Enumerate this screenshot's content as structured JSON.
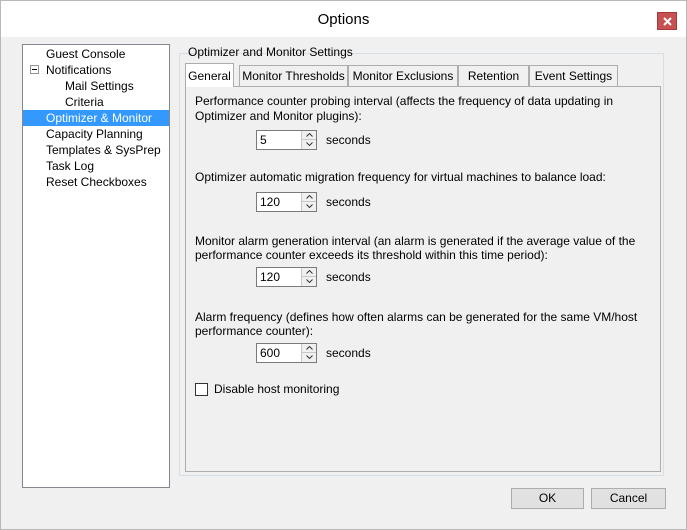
{
  "window": {
    "title": "Options"
  },
  "nav": {
    "items": [
      {
        "label": "Guest Console",
        "selected": false,
        "indent": 0
      },
      {
        "label": "Notifications",
        "selected": false,
        "indent": 0,
        "expander": "minus"
      },
      {
        "label": "Mail Settings",
        "selected": false,
        "indent": 2
      },
      {
        "label": "Criteria",
        "selected": false,
        "indent": 2
      },
      {
        "label": "Optimizer & Monitor",
        "selected": true,
        "indent": 0
      },
      {
        "label": "Capacity Planning",
        "selected": false,
        "indent": 0
      },
      {
        "label": "Templates & SysPrep",
        "selected": false,
        "indent": 0
      },
      {
        "label": "Task Log",
        "selected": false,
        "indent": 0
      },
      {
        "label": "Reset Checkboxes",
        "selected": false,
        "indent": 0
      }
    ]
  },
  "group": {
    "label": "Optimizer and Monitor Settings"
  },
  "tabs": [
    {
      "label": "General",
      "active": true
    },
    {
      "label": "Monitor Thresholds",
      "active": false
    },
    {
      "label": "Monitor Exclusions",
      "active": false
    },
    {
      "label": "Retention",
      "active": false
    },
    {
      "label": "Event Settings",
      "active": false
    }
  ],
  "settings": {
    "probing": {
      "line1": "Performance counter probing interval (affects the frequency of data updating in",
      "line2": "Optimizer and Monitor plugins):",
      "value": "5",
      "unit": "seconds"
    },
    "migration": {
      "line1": "Optimizer automatic migration frequency for virtual machines to balance load:",
      "value": "120",
      "unit": "seconds"
    },
    "alarm_interval": {
      "line1": "Monitor alarm generation interval (an alarm is generated if the average value of the",
      "line2": "performance counter exceeds its threshold within this time period):",
      "value": "120",
      "unit": "seconds"
    },
    "alarm_frequency": {
      "line1": "Alarm frequency (defines how often alarms can be generated for the same VM/host",
      "line2": "performance counter):",
      "value": "600",
      "unit": "seconds"
    },
    "disable_host_monitoring": {
      "label": "Disable host monitoring",
      "checked": false
    }
  },
  "buttons": {
    "ok": "OK",
    "cancel": "Cancel"
  },
  "colors": {
    "selection": "#3399ff",
    "close_button": "#c75050"
  }
}
